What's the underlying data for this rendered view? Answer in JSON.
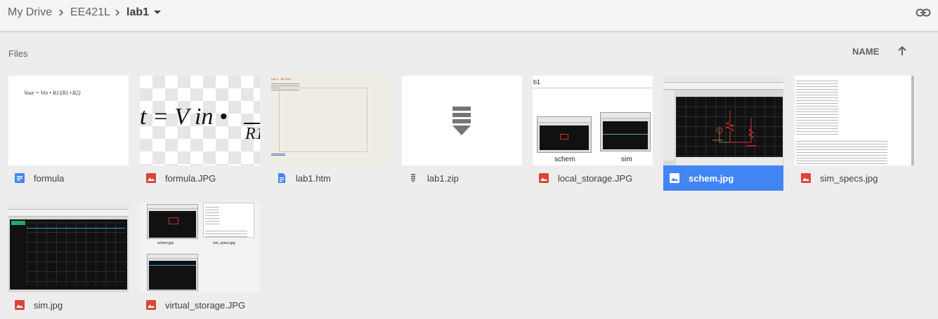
{
  "breadcrumb": {
    "root": "My Drive",
    "parent": "EE421L",
    "current": "lab1"
  },
  "section_label": "Files",
  "sort": {
    "label": "NAME"
  },
  "files": [
    {
      "name": "formula",
      "type": "doc",
      "thumb_text": "Vout = Vin • R1/(R1+R2)"
    },
    {
      "name": "formula.JPG",
      "type": "image",
      "thumb_text": "t = V in •",
      "thumb_sub": "R1"
    },
    {
      "name": "lab1.htm",
      "type": "html",
      "thumb_text": "Lab 1 - EE 421L"
    },
    {
      "name": "lab1.zip",
      "type": "zip"
    },
    {
      "name": "local_storage.JPG",
      "type": "image",
      "thumb_title": "b1",
      "thumb_label_a": "schem",
      "thumb_label_b": "sim"
    },
    {
      "name": "schem.jpg",
      "type": "image",
      "selected": true
    },
    {
      "name": "sim_specs.jpg",
      "type": "image"
    },
    {
      "name": "sim.jpg",
      "type": "image"
    },
    {
      "name": "virtual_storage.JPG",
      "type": "image",
      "thumb_label_a": "schem.jpg",
      "thumb_label_b": "sim_specs.jpg"
    }
  ],
  "colors": {
    "selected": "#4285f4",
    "image_icon": "#db4437",
    "doc_icon": "#4285f4"
  }
}
